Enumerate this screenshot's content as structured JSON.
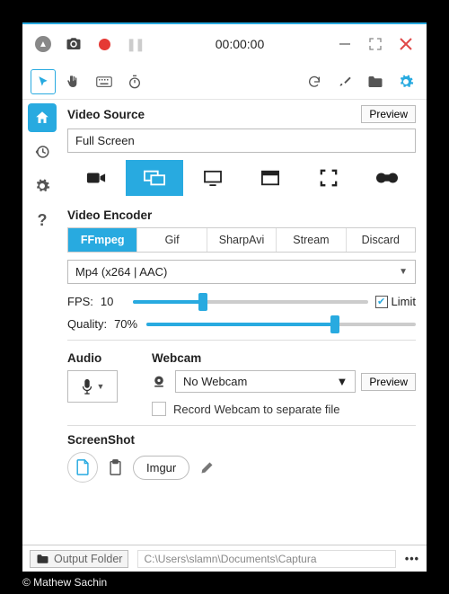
{
  "topbar": {
    "time": "00:00:00"
  },
  "video_source": {
    "heading": "Video Source",
    "preview_label": "Preview",
    "value": "Full Screen",
    "modes": [
      "camera",
      "screen",
      "window",
      "window-alt",
      "region",
      "gamepad"
    ],
    "selected_mode": 1
  },
  "encoder": {
    "heading": "Video Encoder",
    "tabs": [
      "FFmpeg",
      "Gif",
      "SharpAvi",
      "Stream",
      "Discard"
    ],
    "selected_tab": 0,
    "format": "Mp4 (x264 | AAC)",
    "fps_label": "FPS:",
    "fps_value": "10",
    "fps_pct": 30,
    "limit_label": "Limit",
    "limit_checked": true,
    "quality_label": "Quality:",
    "quality_value": "70%",
    "quality_pct": 70
  },
  "audio": {
    "heading": "Audio"
  },
  "webcam": {
    "heading": "Webcam",
    "value": "No Webcam",
    "preview_label": "Preview",
    "separate_label": "Record Webcam to separate file"
  },
  "screenshot": {
    "heading": "ScreenShot",
    "imgur_label": "Imgur"
  },
  "footer": {
    "output_label": "Output Folder",
    "path": "C:\\Users\\slamn\\Documents\\Captura"
  },
  "credit": "© Mathew Sachin"
}
